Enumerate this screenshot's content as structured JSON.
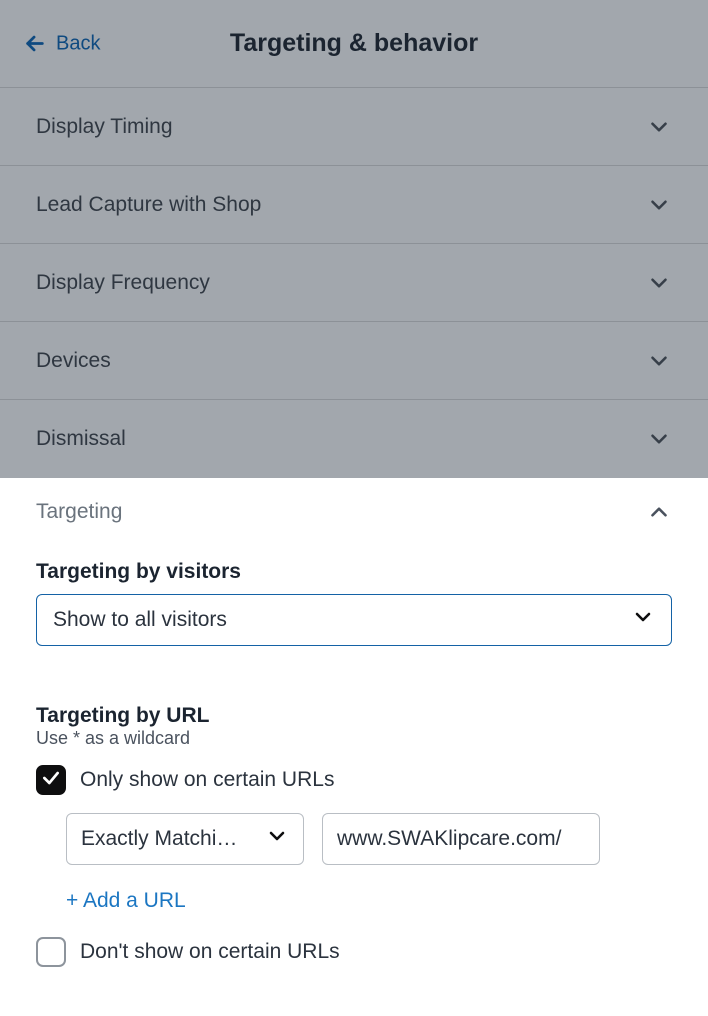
{
  "header": {
    "back_label": "Back",
    "title": "Targeting & behavior"
  },
  "accordion": {
    "items": [
      {
        "label": "Display Timing"
      },
      {
        "label": "Lead Capture with Shop"
      },
      {
        "label": "Display Frequency"
      },
      {
        "label": "Devices"
      },
      {
        "label": "Dismissal"
      }
    ]
  },
  "targeting": {
    "section_label": "Targeting",
    "by_visitors": {
      "label": "Targeting by visitors",
      "selected": "Show to all visitors"
    },
    "by_url": {
      "label": "Targeting by URL",
      "hint": "Use * as a wildcard",
      "only_show": {
        "label": "Only show on certain URLs",
        "checked": true,
        "match_mode": "Exactly Matchi…",
        "url_value": "www.SWAKlipcare.com/"
      },
      "add_url_label": "+ Add a URL",
      "dont_show": {
        "label": "Don't show on certain URLs",
        "checked": false
      }
    }
  }
}
